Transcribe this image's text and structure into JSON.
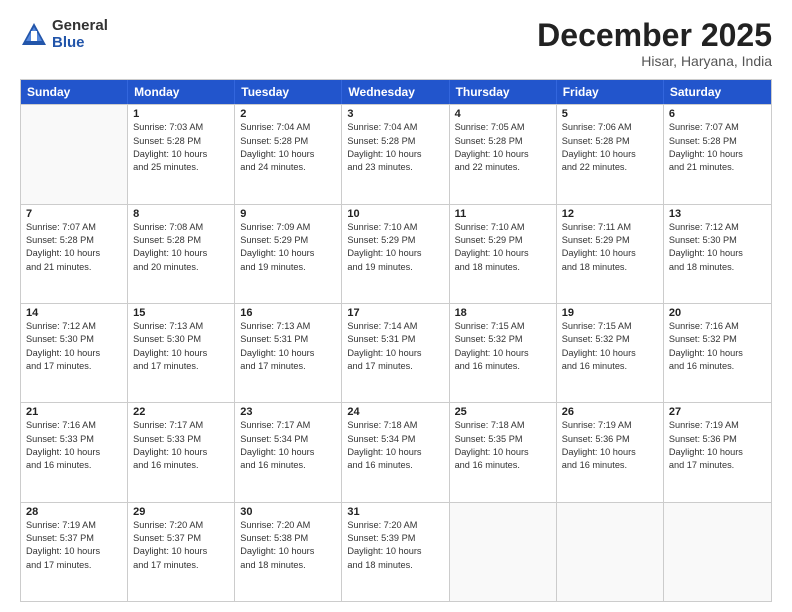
{
  "logo": {
    "general": "General",
    "blue": "Blue"
  },
  "title": "December 2025",
  "location": "Hisar, Haryana, India",
  "days_header": [
    "Sunday",
    "Monday",
    "Tuesday",
    "Wednesday",
    "Thursday",
    "Friday",
    "Saturday"
  ],
  "weeks": [
    [
      {
        "day": "",
        "info": ""
      },
      {
        "day": "1",
        "info": "Sunrise: 7:03 AM\nSunset: 5:28 PM\nDaylight: 10 hours\nand 25 minutes."
      },
      {
        "day": "2",
        "info": "Sunrise: 7:04 AM\nSunset: 5:28 PM\nDaylight: 10 hours\nand 24 minutes."
      },
      {
        "day": "3",
        "info": "Sunrise: 7:04 AM\nSunset: 5:28 PM\nDaylight: 10 hours\nand 23 minutes."
      },
      {
        "day": "4",
        "info": "Sunrise: 7:05 AM\nSunset: 5:28 PM\nDaylight: 10 hours\nand 22 minutes."
      },
      {
        "day": "5",
        "info": "Sunrise: 7:06 AM\nSunset: 5:28 PM\nDaylight: 10 hours\nand 22 minutes."
      },
      {
        "day": "6",
        "info": "Sunrise: 7:07 AM\nSunset: 5:28 PM\nDaylight: 10 hours\nand 21 minutes."
      }
    ],
    [
      {
        "day": "7",
        "info": "Sunrise: 7:07 AM\nSunset: 5:28 PM\nDaylight: 10 hours\nand 21 minutes."
      },
      {
        "day": "8",
        "info": "Sunrise: 7:08 AM\nSunset: 5:28 PM\nDaylight: 10 hours\nand 20 minutes."
      },
      {
        "day": "9",
        "info": "Sunrise: 7:09 AM\nSunset: 5:29 PM\nDaylight: 10 hours\nand 19 minutes."
      },
      {
        "day": "10",
        "info": "Sunrise: 7:10 AM\nSunset: 5:29 PM\nDaylight: 10 hours\nand 19 minutes."
      },
      {
        "day": "11",
        "info": "Sunrise: 7:10 AM\nSunset: 5:29 PM\nDaylight: 10 hours\nand 18 minutes."
      },
      {
        "day": "12",
        "info": "Sunrise: 7:11 AM\nSunset: 5:29 PM\nDaylight: 10 hours\nand 18 minutes."
      },
      {
        "day": "13",
        "info": "Sunrise: 7:12 AM\nSunset: 5:30 PM\nDaylight: 10 hours\nand 18 minutes."
      }
    ],
    [
      {
        "day": "14",
        "info": "Sunrise: 7:12 AM\nSunset: 5:30 PM\nDaylight: 10 hours\nand 17 minutes."
      },
      {
        "day": "15",
        "info": "Sunrise: 7:13 AM\nSunset: 5:30 PM\nDaylight: 10 hours\nand 17 minutes."
      },
      {
        "day": "16",
        "info": "Sunrise: 7:13 AM\nSunset: 5:31 PM\nDaylight: 10 hours\nand 17 minutes."
      },
      {
        "day": "17",
        "info": "Sunrise: 7:14 AM\nSunset: 5:31 PM\nDaylight: 10 hours\nand 17 minutes."
      },
      {
        "day": "18",
        "info": "Sunrise: 7:15 AM\nSunset: 5:32 PM\nDaylight: 10 hours\nand 16 minutes."
      },
      {
        "day": "19",
        "info": "Sunrise: 7:15 AM\nSunset: 5:32 PM\nDaylight: 10 hours\nand 16 minutes."
      },
      {
        "day": "20",
        "info": "Sunrise: 7:16 AM\nSunset: 5:32 PM\nDaylight: 10 hours\nand 16 minutes."
      }
    ],
    [
      {
        "day": "21",
        "info": "Sunrise: 7:16 AM\nSunset: 5:33 PM\nDaylight: 10 hours\nand 16 minutes."
      },
      {
        "day": "22",
        "info": "Sunrise: 7:17 AM\nSunset: 5:33 PM\nDaylight: 10 hours\nand 16 minutes."
      },
      {
        "day": "23",
        "info": "Sunrise: 7:17 AM\nSunset: 5:34 PM\nDaylight: 10 hours\nand 16 minutes."
      },
      {
        "day": "24",
        "info": "Sunrise: 7:18 AM\nSunset: 5:34 PM\nDaylight: 10 hours\nand 16 minutes."
      },
      {
        "day": "25",
        "info": "Sunrise: 7:18 AM\nSunset: 5:35 PM\nDaylight: 10 hours\nand 16 minutes."
      },
      {
        "day": "26",
        "info": "Sunrise: 7:19 AM\nSunset: 5:36 PM\nDaylight: 10 hours\nand 16 minutes."
      },
      {
        "day": "27",
        "info": "Sunrise: 7:19 AM\nSunset: 5:36 PM\nDaylight: 10 hours\nand 17 minutes."
      }
    ],
    [
      {
        "day": "28",
        "info": "Sunrise: 7:19 AM\nSunset: 5:37 PM\nDaylight: 10 hours\nand 17 minutes."
      },
      {
        "day": "29",
        "info": "Sunrise: 7:20 AM\nSunset: 5:37 PM\nDaylight: 10 hours\nand 17 minutes."
      },
      {
        "day": "30",
        "info": "Sunrise: 7:20 AM\nSunset: 5:38 PM\nDaylight: 10 hours\nand 18 minutes."
      },
      {
        "day": "31",
        "info": "Sunrise: 7:20 AM\nSunset: 5:39 PM\nDaylight: 10 hours\nand 18 minutes."
      },
      {
        "day": "",
        "info": ""
      },
      {
        "day": "",
        "info": ""
      },
      {
        "day": "",
        "info": ""
      }
    ]
  ]
}
